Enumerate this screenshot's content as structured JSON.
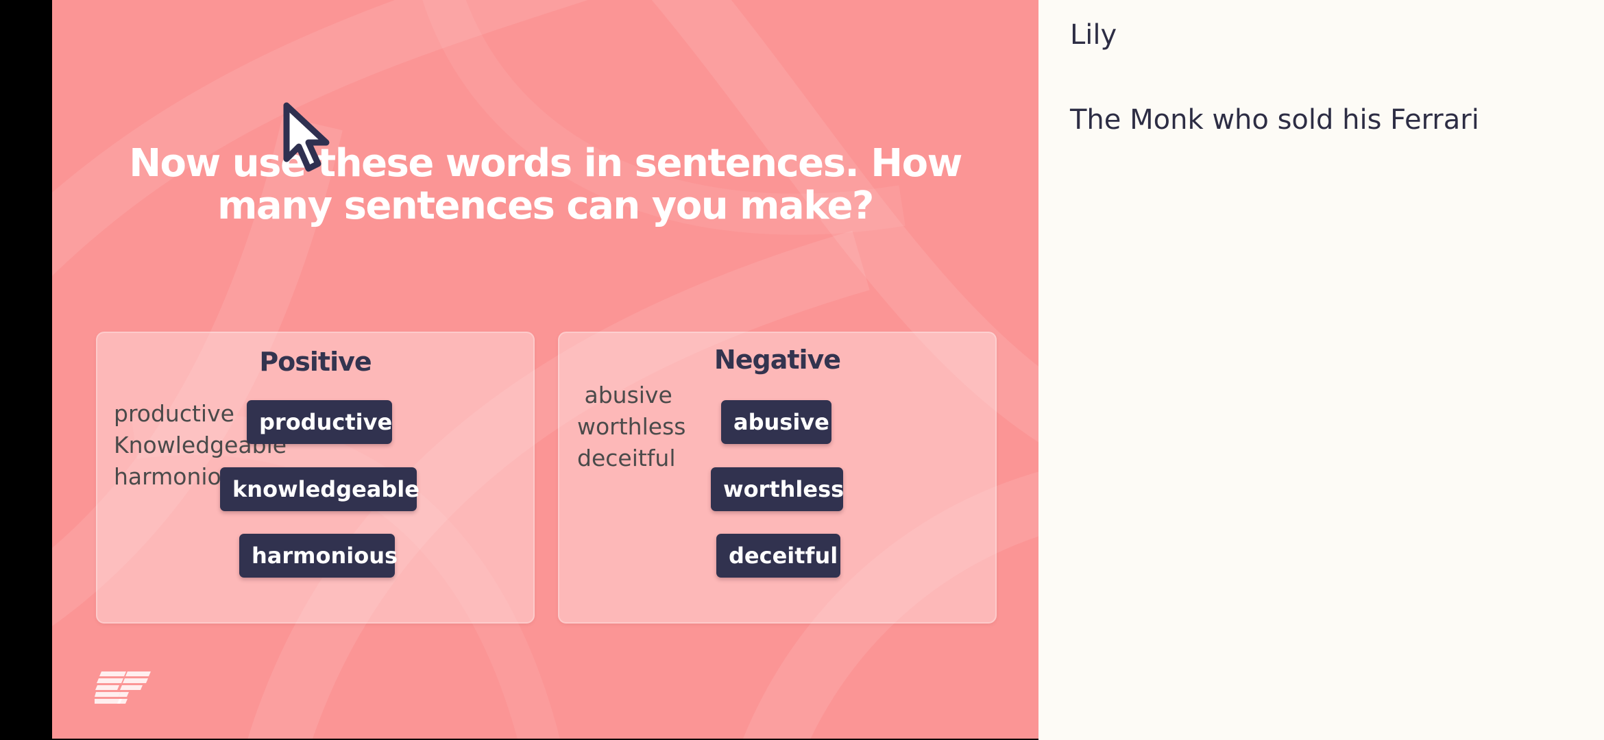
{
  "slide": {
    "title": "Now use these words in sentences. How many sentences can you make?",
    "logo_text": "EF",
    "colors": {
      "background": "#fb9595",
      "chip": "#31324f",
      "heading": "#33344f"
    },
    "positive": {
      "heading": "Positive",
      "handwritten": "productive\nKnowledgeable\nharmonious",
      "words": [
        "productive",
        "knowledgeable",
        "harmonious"
      ]
    },
    "negative": {
      "heading": "Negative",
      "handwritten": " abusive\nworthless\ndeceitful",
      "words": [
        "abusive",
        "worthless",
        "deceitful"
      ]
    },
    "pointer_icon": "cursor-arrow-icon"
  },
  "side_panel": {
    "name": "Lily",
    "book": "The Monk who sold his Ferrari"
  }
}
